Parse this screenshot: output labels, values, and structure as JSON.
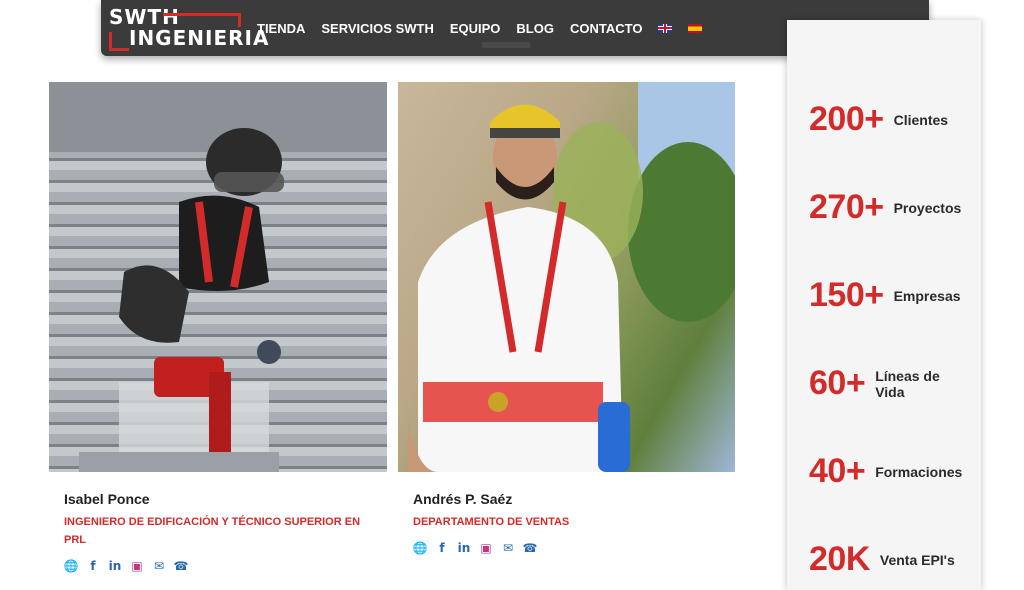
{
  "logo": {
    "line1": "SWTH",
    "line2": "INGENIERIA"
  },
  "nav": {
    "items": [
      "TIENDA",
      "SERVICIOS SWTH",
      "EQUIPO",
      "BLOG",
      "CONTACTO"
    ],
    "flags": [
      "uk-flag-icon",
      "es-flag-icon"
    ]
  },
  "team": [
    {
      "name": "Isabel Ponce",
      "role": "INGENIERO DE EDIFICACIÓN Y TÉCNICO SUPERIOR EN PRL",
      "socials": [
        "globe-icon",
        "facebook-icon",
        "linkedin-icon",
        "instagram-icon",
        "email-icon",
        "phone-icon"
      ]
    },
    {
      "name": "Andrés P. Saéz",
      "role": "DEPARTAMENTO DE VENTAS",
      "socials": [
        "globe-icon",
        "facebook-icon",
        "linkedin-icon",
        "instagram-icon",
        "email-icon",
        "phone-icon"
      ]
    }
  ],
  "stats": [
    {
      "number": "200+",
      "label": "Clientes"
    },
    {
      "number": "270+",
      "label": "Proyectos"
    },
    {
      "number": "150+",
      "label": "Empresas"
    },
    {
      "number": "60+",
      "label": "Líneas de Vida"
    },
    {
      "number": "40+",
      "label": "Formaciones"
    },
    {
      "number": "20K",
      "label": "Venta EPI's"
    }
  ],
  "colors": {
    "accent": "#d32a2a",
    "nav_bg": "#3b3b3b",
    "icon_blue": "#2a67b1"
  }
}
